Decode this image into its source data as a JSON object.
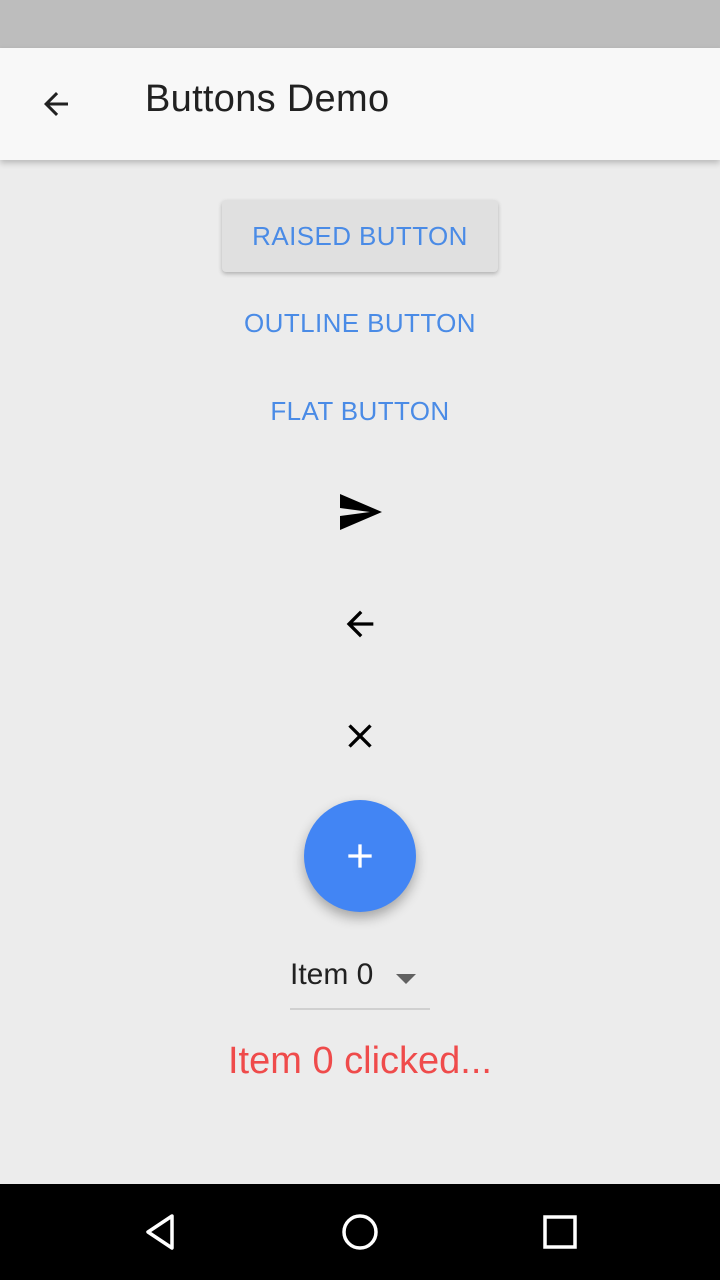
{
  "app_bar": {
    "title": "Buttons Demo",
    "back_icon": "arrow-back-icon"
  },
  "buttons": {
    "raised_label": "RAISED BUTTON",
    "outline_label": "OUTLINE BUTTON",
    "flat_label": "FLAT BUTTON",
    "icon_buttons": [
      "send-icon",
      "arrow-back-icon",
      "close-icon"
    ],
    "fab_icon": "add-icon"
  },
  "dropdown": {
    "selected": "Item 0",
    "icon": "arrow-drop-down-icon"
  },
  "status": {
    "text": "Item 0 clicked..."
  },
  "navigation_bar": {
    "icons": [
      "nav-back-icon",
      "nav-home-icon",
      "nav-recents-icon"
    ]
  },
  "colors": {
    "accent": "#4285f4",
    "button_text": "#4a8be6",
    "status_text": "#ef4b4b",
    "background": "#ececec",
    "app_bar": "#f8f8f8"
  }
}
